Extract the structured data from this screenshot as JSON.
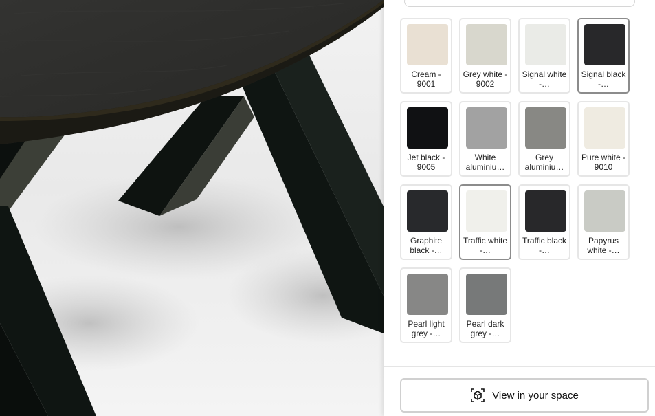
{
  "colors": {
    "panel_bg": "#ffffff",
    "swatch_border": "#e6e6e6",
    "swatch_selected_border": "#8c8c8c",
    "tabletop": "#2b2b2a",
    "leg": "#0f1512"
  },
  "swatches": [
    {
      "label": "Cream - 9001",
      "color": "#e9e0d3",
      "selected": false
    },
    {
      "label": "Grey white - 9002",
      "color": "#d8d7cd",
      "selected": false
    },
    {
      "label": "Signal white -…",
      "color": "#eaebe7",
      "selected": false
    },
    {
      "label": "Signal black -…",
      "color": "#28282a",
      "selected": true
    },
    {
      "label": "Jet black - 9005",
      "color": "#101113",
      "selected": false
    },
    {
      "label": "White aluminiu…",
      "color": "#a2a2a2",
      "selected": false
    },
    {
      "label": "Grey aluminiu…",
      "color": "#888884",
      "selected": false
    },
    {
      "label": "Pure white - 9010",
      "color": "#efebe1",
      "selected": false
    },
    {
      "label": "Graphite black -…",
      "color": "#28292c",
      "selected": false
    },
    {
      "label": "Traffic white -…",
      "color": "#f0f0eb",
      "selected": true
    },
    {
      "label": "Traffic black -…",
      "color": "#28282a",
      "selected": false
    },
    {
      "label": "Papyrus white -…",
      "color": "#c9cbc5",
      "selected": false
    },
    {
      "label": "Pearl light grey -…",
      "color": "#878786",
      "selected": false
    },
    {
      "label": "Pearl dark grey -…",
      "color": "#777979",
      "selected": false
    }
  ],
  "ar_button": {
    "label": "View in your space",
    "icon": "ar-cube-icon"
  }
}
